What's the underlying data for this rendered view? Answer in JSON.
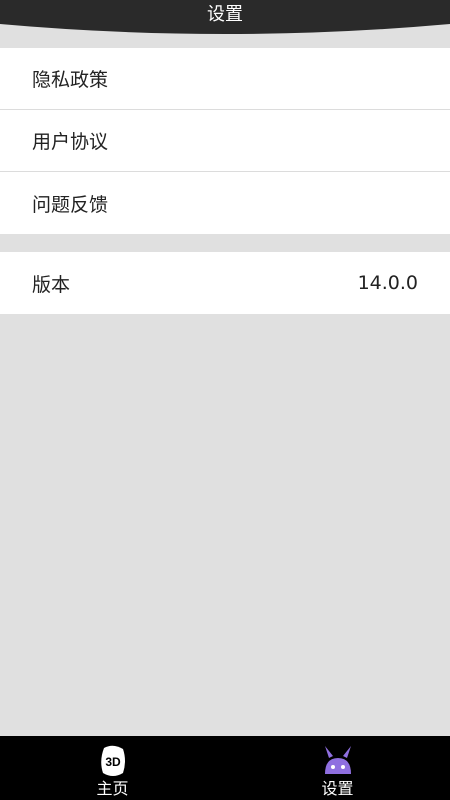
{
  "header": {
    "title": "设置"
  },
  "settings": {
    "group1": [
      {
        "label": "隐私政策"
      },
      {
        "label": "用户协议"
      },
      {
        "label": "问题反馈"
      }
    ],
    "version": {
      "label": "版本",
      "value": "14.0.0"
    }
  },
  "bottom_nav": {
    "items": [
      {
        "label": "主页",
        "icon": "3d-icon"
      },
      {
        "label": "设置",
        "icon": "bunny-icon",
        "active": true
      }
    ]
  },
  "colors": {
    "header_bg": "#2a2a2a",
    "page_bg": "#e0e0e0",
    "nav_bg": "#000000",
    "accent_purple": "#8f6fe0"
  }
}
